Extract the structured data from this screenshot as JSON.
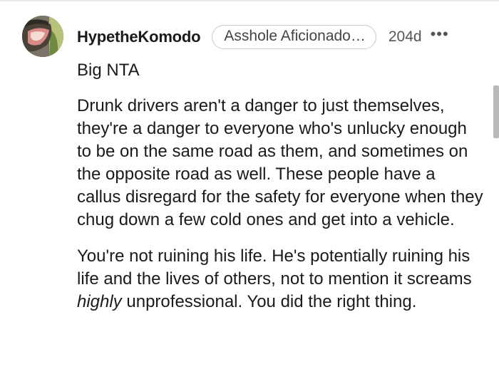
{
  "comment": {
    "username": "HypetheKomodo",
    "flair": "Asshole Aficionado…",
    "age": "204d",
    "more_icon": "ellipsis-icon",
    "more_glyph": "•••",
    "avatar_icon": "komodo-avatar",
    "paragraphs": [
      {
        "text": "Big NTA"
      },
      {
        "text": "Drunk drivers aren't a danger to just themselves, they're a danger to everyone who's unlucky enough to be on the same road as them, and sometimes on the opposite road as well. These people have a callus disregard for the safety for everyone when they chug down a few cold ones and get into a vehicle."
      },
      {
        "before": "You're not ruining his life. He's potentially ruining his life and the lives of others, not to mention it screams ",
        "emphasis": "highly",
        "after": " unprofessional. You did the right thing."
      }
    ]
  },
  "colors": {
    "text": "#1a1a1b",
    "muted": "#555555",
    "flair_border": "#c9c9c9",
    "scrollbar": "#b9b9b9"
  }
}
